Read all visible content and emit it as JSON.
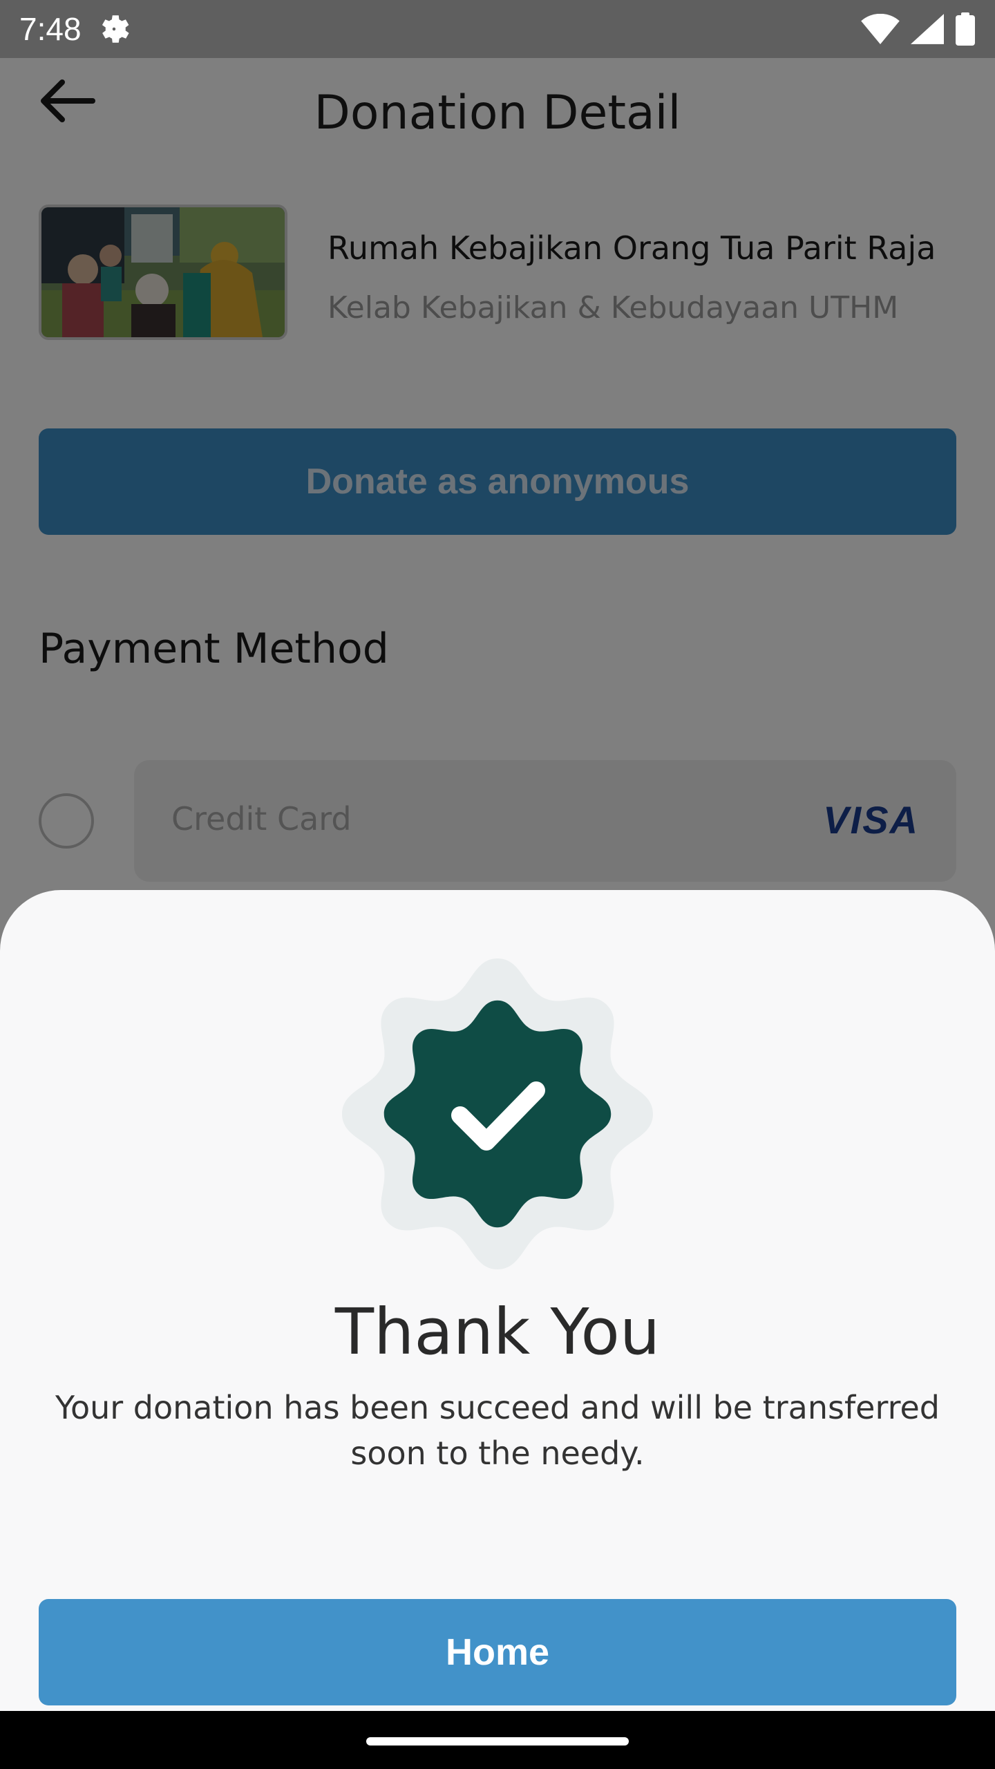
{
  "status_bar": {
    "time": "7:48",
    "icons": [
      "settings-gear-icon",
      "wifi-icon",
      "signal-icon",
      "battery-icon"
    ]
  },
  "header": {
    "title": "Donation Detail",
    "back_icon": "arrow-left-icon"
  },
  "campaign": {
    "title": "Rumah Kebajikan Orang Tua Parit Raja",
    "organizer": "Kelab Kebajikan & Kebudayaan UTHM"
  },
  "anonymous_button": {
    "label": "Donate as anonymous"
  },
  "payment": {
    "section_title": "Payment Method",
    "options": [
      {
        "label": "Credit Card",
        "brand": "VISA",
        "selected": false
      }
    ]
  },
  "dialog": {
    "icon": "verified-badge-check-icon",
    "title": "Thank You",
    "message": "Your donation has been succeed and will be transferred soon to the needy.",
    "button_label": "Home"
  },
  "colors": {
    "primary": "#4292C9",
    "badge": "#0F4C45",
    "badge_halo": "#E9EDEE",
    "sheet_background": "#F8F8F9"
  }
}
